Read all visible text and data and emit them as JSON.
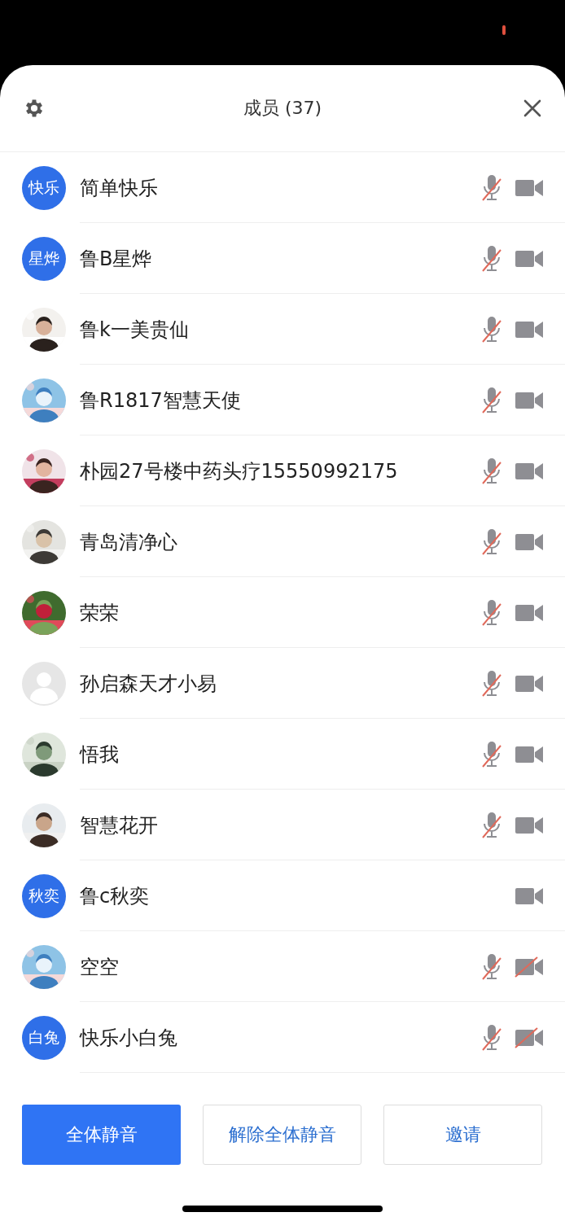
{
  "title": "成员 (37)",
  "members": [
    {
      "name": "简单快乐",
      "avatar": {
        "kind": "text",
        "text": "快乐"
      },
      "mic_shown": true,
      "mic_muted": true,
      "video_off": false
    },
    {
      "name": "鲁B星烨",
      "avatar": {
        "kind": "text",
        "text": "星烨"
      },
      "mic_shown": true,
      "mic_muted": true,
      "video_off": false
    },
    {
      "name": "鲁k一美贵仙",
      "mic_shown": true,
      "mic_muted": true,
      "video_off": false
    },
    {
      "name": "鲁R1817智慧天使",
      "mic_shown": true,
      "mic_muted": true,
      "video_off": false
    },
    {
      "name": "朴园27号楼中药头疗15550992175",
      "mic_shown": true,
      "mic_muted": true,
      "video_off": false
    },
    {
      "name": "青岛清净心",
      "mic_shown": true,
      "mic_muted": true,
      "video_off": false
    },
    {
      "name": "荣荣",
      "mic_shown": true,
      "mic_muted": true,
      "video_off": false
    },
    {
      "name": "孙启森天才小易",
      "avatar": {
        "kind": "default"
      },
      "mic_shown": true,
      "mic_muted": true,
      "video_off": false
    },
    {
      "name": "悟我",
      "mic_shown": true,
      "mic_muted": true,
      "video_off": false
    },
    {
      "name": "智慧花开",
      "mic_shown": true,
      "mic_muted": true,
      "video_off": false
    },
    {
      "name": "鲁c秋奕",
      "avatar": {
        "kind": "text",
        "text": "秋奕"
      },
      "mic_shown": false,
      "video_off": false
    },
    {
      "name": "空空",
      "mic_shown": true,
      "mic_muted": true,
      "video_off": true
    },
    {
      "name": "快乐小白兔",
      "avatar": {
        "kind": "text",
        "text": "白兔"
      },
      "mic_shown": true,
      "mic_muted": true,
      "video_off": true
    }
  ],
  "buttons": [
    {
      "label": "全体静音",
      "primary": true
    },
    {
      "label": "解除全体静音",
      "primary": false
    },
    {
      "label": "邀请",
      "primary": false
    }
  ]
}
